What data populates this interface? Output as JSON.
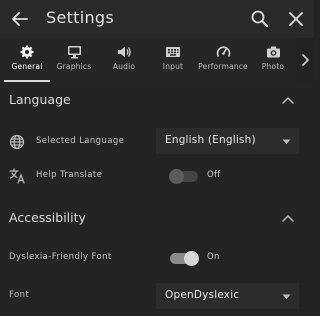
{
  "header": {
    "title": "Settings",
    "icons": [
      "back-arrow-icon",
      "search-icon",
      "close-icon"
    ]
  },
  "tabs": [
    {
      "label": "General",
      "icon": "gear-icon",
      "active": true
    },
    {
      "label": "Graphics",
      "icon": "monitor-icon",
      "active": false
    },
    {
      "label": "Audio",
      "icon": "speaker-icon",
      "active": false
    },
    {
      "label": "Input",
      "icon": "keyboard-icon",
      "active": false
    },
    {
      "label": "Performance",
      "icon": "gauge-icon",
      "active": false
    },
    {
      "label": "Photo",
      "icon": "camera-icon",
      "active": false
    }
  ],
  "sections": {
    "language": {
      "title": "Language",
      "selected_language_label": "Selected Language",
      "selected_language_value": "English  (English)",
      "help_translate_label": "Help Translate",
      "help_translate_state": "Off",
      "help_translate_on": false
    },
    "accessibility": {
      "title": "Accessibility",
      "dyslexia_font_label": "Dyslexia-Friendly Font",
      "dyslexia_font_state": "On",
      "dyslexia_font_on": true,
      "font_label": "Font",
      "font_value": "OpenDyslexic"
    }
  },
  "colors": {
    "background": "#242424",
    "toggle_off_track": "#444444",
    "toggle_off_knob": "#5c5c5c",
    "toggle_on_track": "#8a8a8a",
    "toggle_on_knob": "#d6d6d6"
  }
}
